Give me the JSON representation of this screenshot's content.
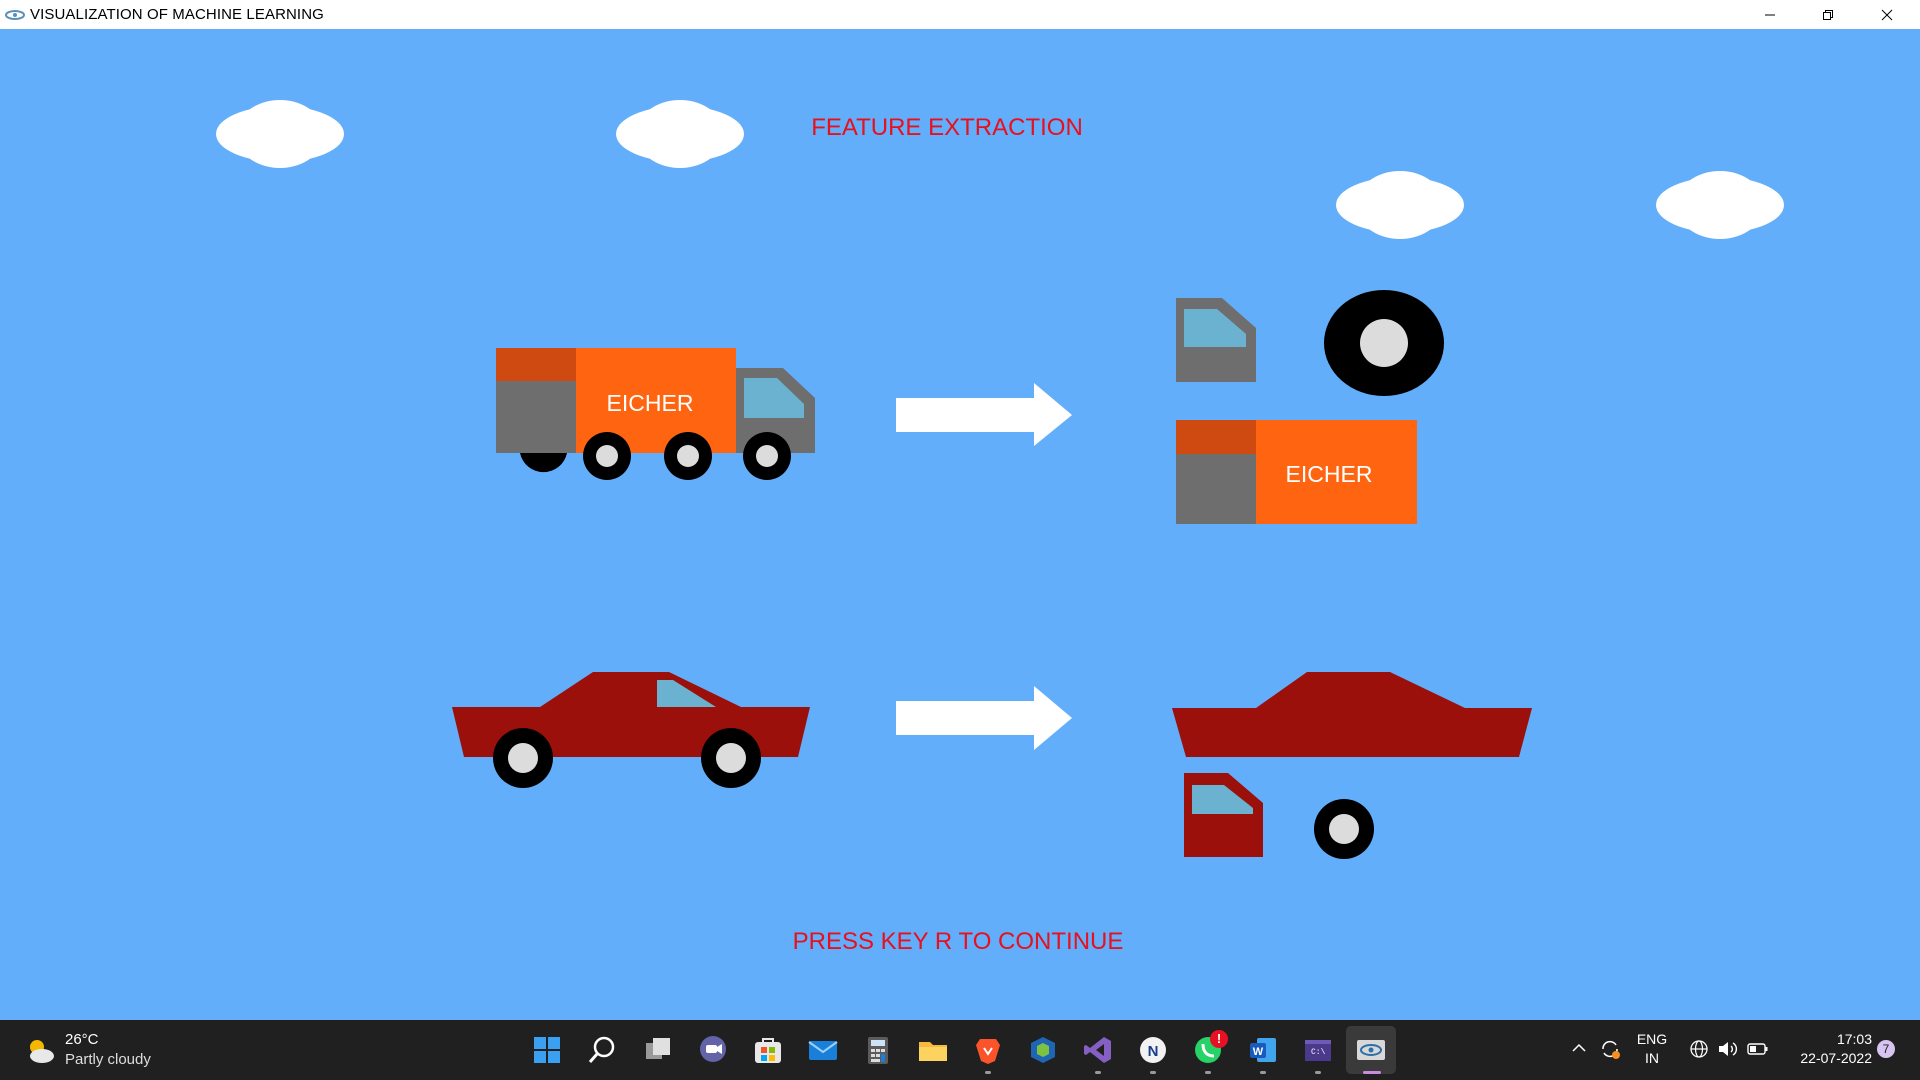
{
  "window": {
    "title": "VISUALIZATION OF MACHINE LEARNING",
    "icon": "opengl-eye-icon"
  },
  "scene": {
    "heading": "FEATURE EXTRACTION",
    "footer": "PRESS KEY R TO CONTINUE",
    "truck_label": "EICHER",
    "truck_body_label": "EICHER",
    "colors": {
      "sky": "#63aefa",
      "text_red": "#e8101c",
      "truck_orange": "#ff6510",
      "truck_dark_orange": "#cf4a10",
      "gray": "#6e6e6e",
      "window_blue": "#6ab2d0",
      "car_red": "#9b100a",
      "wheel_black": "#000000",
      "hubcap": "#dcdcdc",
      "arrow": "#ffffff",
      "cloud": "#ffffff"
    }
  },
  "taskbar": {
    "weather": {
      "temp": "26°C",
      "condition": "Partly cloudy",
      "icon": "partly-cloudy-icon"
    },
    "apps": [
      "start-icon",
      "search-icon",
      "task-view-icon",
      "teams-chat-icon",
      "microsoft-store-icon",
      "mail-icon",
      "calculator-icon",
      "file-explorer-icon",
      "brave-icon",
      "virtualbox-icon",
      "visual-studio-icon",
      "app-icon",
      "whatsapp-icon",
      "word-icon",
      "terminal-icon",
      "opengl-app-icon"
    ],
    "whatsapp_badge": "!",
    "lang_line1": "ENG",
    "lang_line2": "IN",
    "time": "17:03",
    "date": "22-07-2022",
    "notification_count": "7"
  }
}
